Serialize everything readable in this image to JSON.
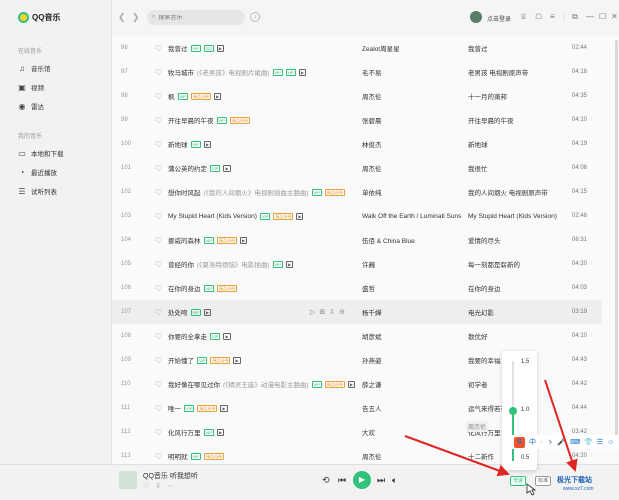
{
  "app": {
    "title": "QQ音乐"
  },
  "sidebar": {
    "online_title": "在线音乐",
    "mine_title": "我的音乐",
    "items": [
      {
        "label": "音乐馆",
        "icon": "music-note-icon"
      },
      {
        "label": "视频",
        "icon": "video-icon"
      },
      {
        "label": "雷达",
        "icon": "radar-icon"
      },
      {
        "label": "本地和下载",
        "icon": "computer-icon"
      },
      {
        "label": "最近播放",
        "icon": "history-icon"
      },
      {
        "label": "试听列表",
        "icon": "playlist-icon"
      }
    ]
  },
  "header": {
    "search_placeholder": "搜索音乐",
    "login_label": "点击登录"
  },
  "songs": [
    {
      "num": "96",
      "title": "我曾过",
      "sub": "",
      "tags": [
        "vip",
        "sq",
        "mv"
      ],
      "artist": "Zealot周星星",
      "album": "我曾过",
      "duration": "02:44"
    },
    {
      "num": "97",
      "title": "牧马城市",
      "sub": "(《老男孩》电视剧片尾曲)",
      "tags": [
        "vip",
        "hr",
        "mv"
      ],
      "artist": "毛不易",
      "album": "老男孩 电视剧原声带",
      "duration": "04:18"
    },
    {
      "num": "98",
      "title": "枫",
      "sub": "",
      "tags": [
        "vip",
        "gold",
        "mv"
      ],
      "artist": "周杰伦",
      "album": "十一月的萧邦",
      "duration": "04:35"
    },
    {
      "num": "99",
      "title": "开往早晨的午夜",
      "sub": "",
      "tags": [
        "vip",
        "gold"
      ],
      "artist": "张碧晨",
      "album": "开往早晨的午夜",
      "duration": "04:10"
    },
    {
      "num": "100",
      "title": "新地球",
      "sub": "",
      "tags": [
        "vip",
        "mv"
      ],
      "artist": "林俊杰",
      "album": "新地球",
      "duration": "04:19"
    },
    {
      "num": "101",
      "title": "蒲公英的约定",
      "sub": "",
      "tags": [
        "vip",
        "mv"
      ],
      "artist": "周杰伦",
      "album": "我很忙",
      "duration": "04:06"
    },
    {
      "num": "102",
      "title": "想你时风起",
      "sub": "(《我的人间烟火》电视剧插曲主题曲)",
      "tags": [
        "vip",
        "gold"
      ],
      "artist": "单依纯",
      "album": "我的人间烟火 电视剧原声带",
      "duration": "04:15"
    },
    {
      "num": "103",
      "title": "My Stupid Heart (Kids Version)",
      "sub": "",
      "tags": [
        "vip",
        "gold",
        "mv"
      ],
      "artist": "Walk Off the Earth / Luminati Suns",
      "album": "My Stupid Heart (Kids Version)",
      "duration": "02:48"
    },
    {
      "num": "104",
      "title": "挪威的森林",
      "sub": "",
      "tags": [
        "vip",
        "gold",
        "mv"
      ],
      "artist": "伍佰 & China Blue",
      "album": "爱情的尽头",
      "duration": "06:31"
    },
    {
      "num": "105",
      "title": "曾经的你",
      "sub": "(《夏洛特烦恼》电影插曲)",
      "tags": [
        "vip",
        "mv"
      ],
      "artist": "许巍",
      "album": "每一刻都是崭新的",
      "duration": "04:20"
    },
    {
      "num": "106",
      "title": "在你的身边",
      "sub": "",
      "tags": [
        "vip",
        "gold"
      ],
      "artist": "盛哲",
      "album": "在你的身边",
      "duration": "04:03"
    },
    {
      "num": "107",
      "title": "处处吻",
      "sub": "",
      "tags": [
        "vip",
        "mv"
      ],
      "artist": "杨千嬅",
      "album": "电光幻影",
      "duration": "03:19"
    },
    {
      "num": "108",
      "title": "你要的全拿走",
      "sub": "",
      "tags": [
        "vip",
        "mv"
      ],
      "artist": "胡彦斌",
      "album": "散优好",
      "duration": "04:10"
    },
    {
      "num": "109",
      "title": "开始懂了",
      "sub": "",
      "tags": [
        "vip",
        "gold",
        "mv"
      ],
      "artist": "孙燕姿",
      "album": "我要的幸福",
      "duration": "04:43"
    },
    {
      "num": "110",
      "title": "我好像在哪见过你",
      "sub": "(《精灵王座》动漫电影主题曲)",
      "tags": [
        "vip",
        "gold",
        "mv"
      ],
      "artist": "薛之谦",
      "album": "初学者",
      "duration": "04:42"
    },
    {
      "num": "111",
      "title": "唯一",
      "sub": "",
      "tags": [
        "vip",
        "gold",
        "mv"
      ],
      "artist": "告五人",
      "album": "运气来得若有似无",
      "duration": "04:44"
    },
    {
      "num": "112",
      "title": "化风行万里",
      "sub": "",
      "tags": [
        "vip",
        "mv"
      ],
      "artist": "大欢",
      "album": "化风行万里",
      "duration": "03:42"
    },
    {
      "num": "113",
      "title": "明明就",
      "sub": "",
      "tags": [
        "vip",
        "gold"
      ],
      "artist": "周杰伦",
      "album": "十二新作",
      "duration": "04:20"
    }
  ],
  "tag_labels": {
    "vip": "VIP",
    "sq": "SQ",
    "hr": "HR",
    "gold": "臻品母带",
    "mv": "▶"
  },
  "player": {
    "now_playing": "QQ音乐 听我想听",
    "speed_pill": "倍速",
    "quality_pill": "标准"
  },
  "speed": {
    "options": [
      "1.5",
      "1.0",
      "0.5"
    ],
    "current": 1.0,
    "min": 0.5,
    "max": 1.5
  },
  "tooltip": "周杰伦",
  "ime": {
    "logo": "S",
    "items": [
      "中",
      "·",
      "ゝ",
      "🎤",
      "⌨",
      "👕",
      "☰",
      "☺"
    ]
  },
  "watermark": {
    "main": "极光下载站",
    "sub": "www.xz7.com"
  },
  "colors": {
    "accent": "#31c27c",
    "arrow": "#e02424"
  }
}
